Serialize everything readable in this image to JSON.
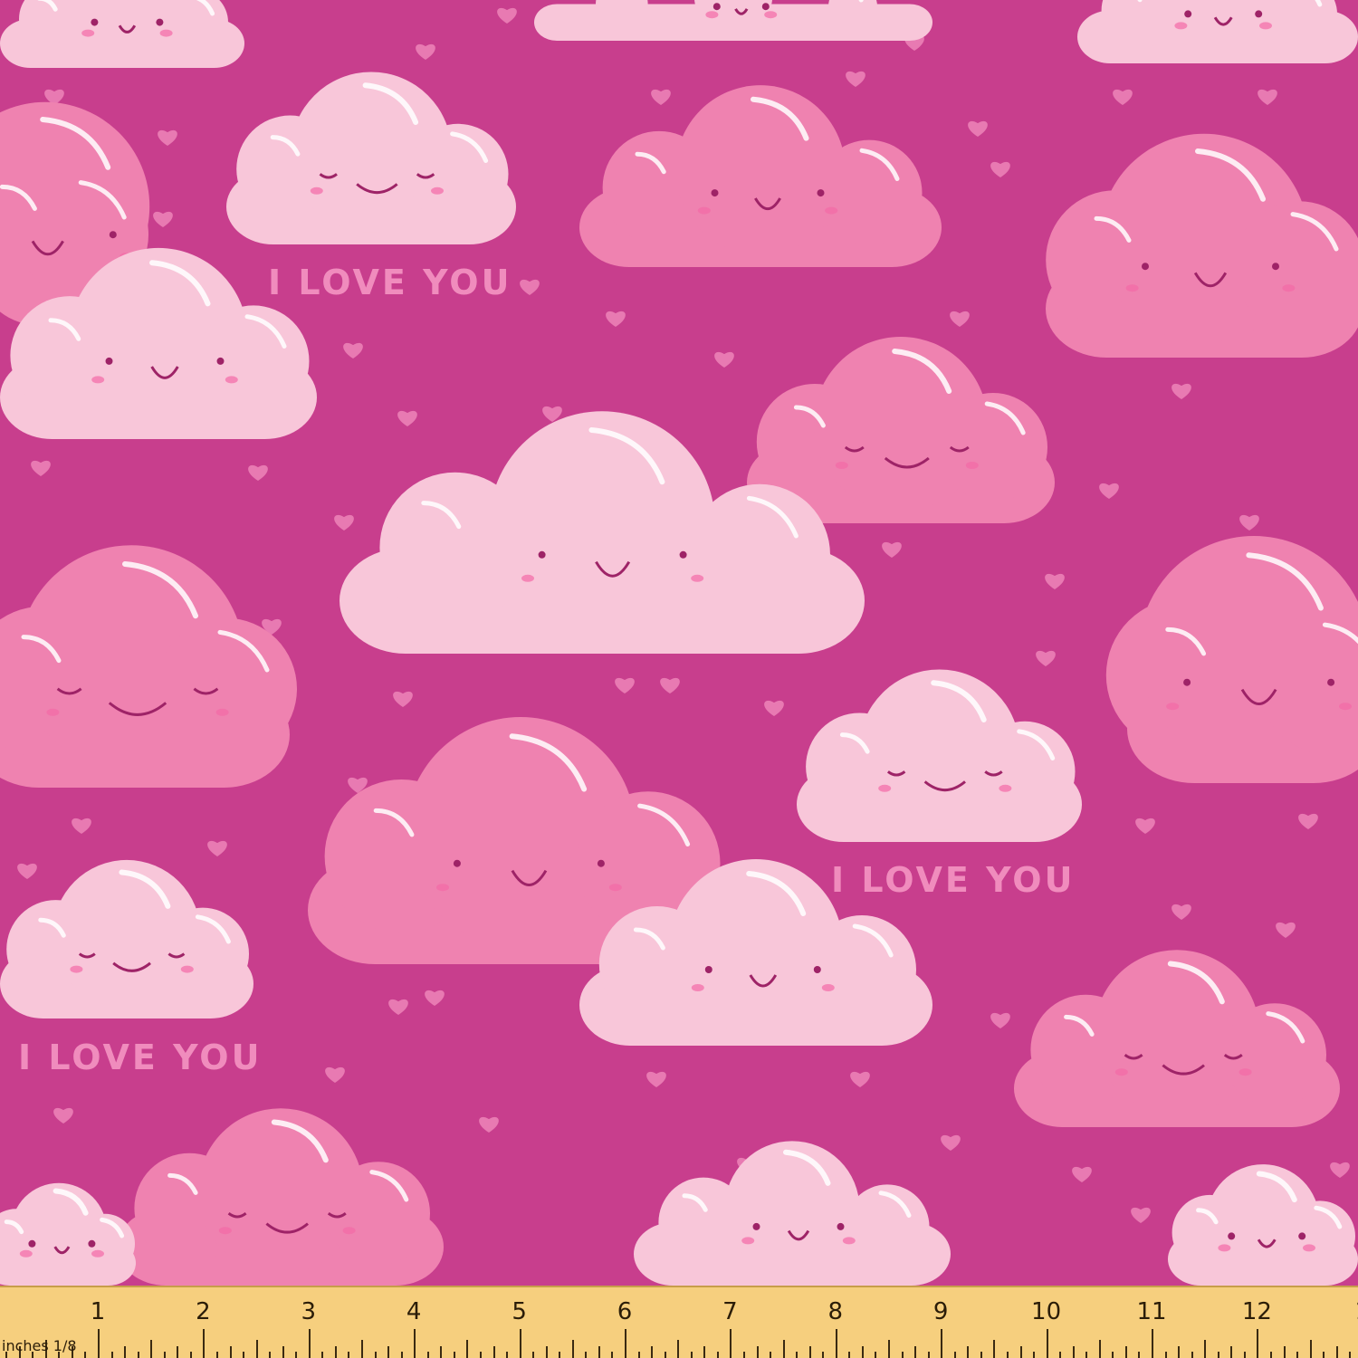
{
  "pattern": {
    "background_color": "#c83e8d",
    "cloud_light_color": "#f8c6d9",
    "cloud_pink_color": "#ef82b0",
    "heart_color": "#e87ab2",
    "face_color": "#9e2367",
    "text_color": "#f08cbd",
    "phrase": "I LOVE YOU"
  },
  "ruler": {
    "numbers": [
      "1",
      "2",
      "3",
      "4",
      "5",
      "6",
      "7",
      "8",
      "9",
      "10",
      "11",
      "12",
      "1"
    ],
    "unit_label": "inches 1/8",
    "color": "#f6cf7e"
  }
}
